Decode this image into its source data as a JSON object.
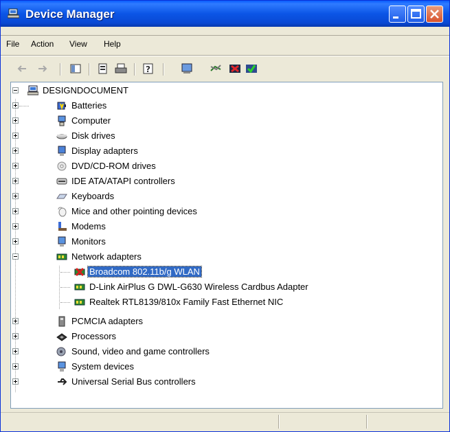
{
  "window": {
    "title": "Device Manager"
  },
  "menu": [
    "File",
    "Action",
    "View",
    "Help"
  ],
  "tree": {
    "root": "DESIGNDOCUMENT",
    "categories": [
      {
        "label": "Batteries",
        "icon": "battery-icon"
      },
      {
        "label": "Computer",
        "icon": "computer-icon"
      },
      {
        "label": "Disk drives",
        "icon": "disk-drive-icon"
      },
      {
        "label": "Display adapters",
        "icon": "display-adapter-icon"
      },
      {
        "label": "DVD/CD-ROM drives",
        "icon": "dvd-drive-icon"
      },
      {
        "label": "IDE ATA/ATAPI controllers",
        "icon": "ide-controller-icon"
      },
      {
        "label": "Keyboards",
        "icon": "keyboard-icon"
      },
      {
        "label": "Mice and other pointing devices",
        "icon": "mouse-icon"
      },
      {
        "label": "Modems",
        "icon": "modem-icon"
      },
      {
        "label": "Monitors",
        "icon": "monitor-icon"
      },
      {
        "label": "Network adapters",
        "icon": "network-adapter-icon",
        "expanded": true,
        "children": [
          {
            "label": "Broadcom 802.11b/g WLAN",
            "selected": true,
            "disabled": true
          },
          {
            "label": "D-Link AirPlus G DWL-G630 Wireless Cardbus Adapter"
          },
          {
            "label": "Realtek RTL8139/810x Family Fast Ethernet NIC"
          }
        ]
      },
      {
        "label": "PCMCIA adapters",
        "icon": "pcmcia-icon"
      },
      {
        "label": "Processors",
        "icon": "processor-icon"
      },
      {
        "label": "Sound, video and game controllers",
        "icon": "sound-icon"
      },
      {
        "label": "System devices",
        "icon": "system-device-icon"
      },
      {
        "label": "Universal Serial Bus controllers",
        "icon": "usb-icon"
      }
    ]
  },
  "colors": {
    "titlebar": "#0a55e6",
    "selection": "#316ac5",
    "disabled_mark": "#d81e1e"
  }
}
